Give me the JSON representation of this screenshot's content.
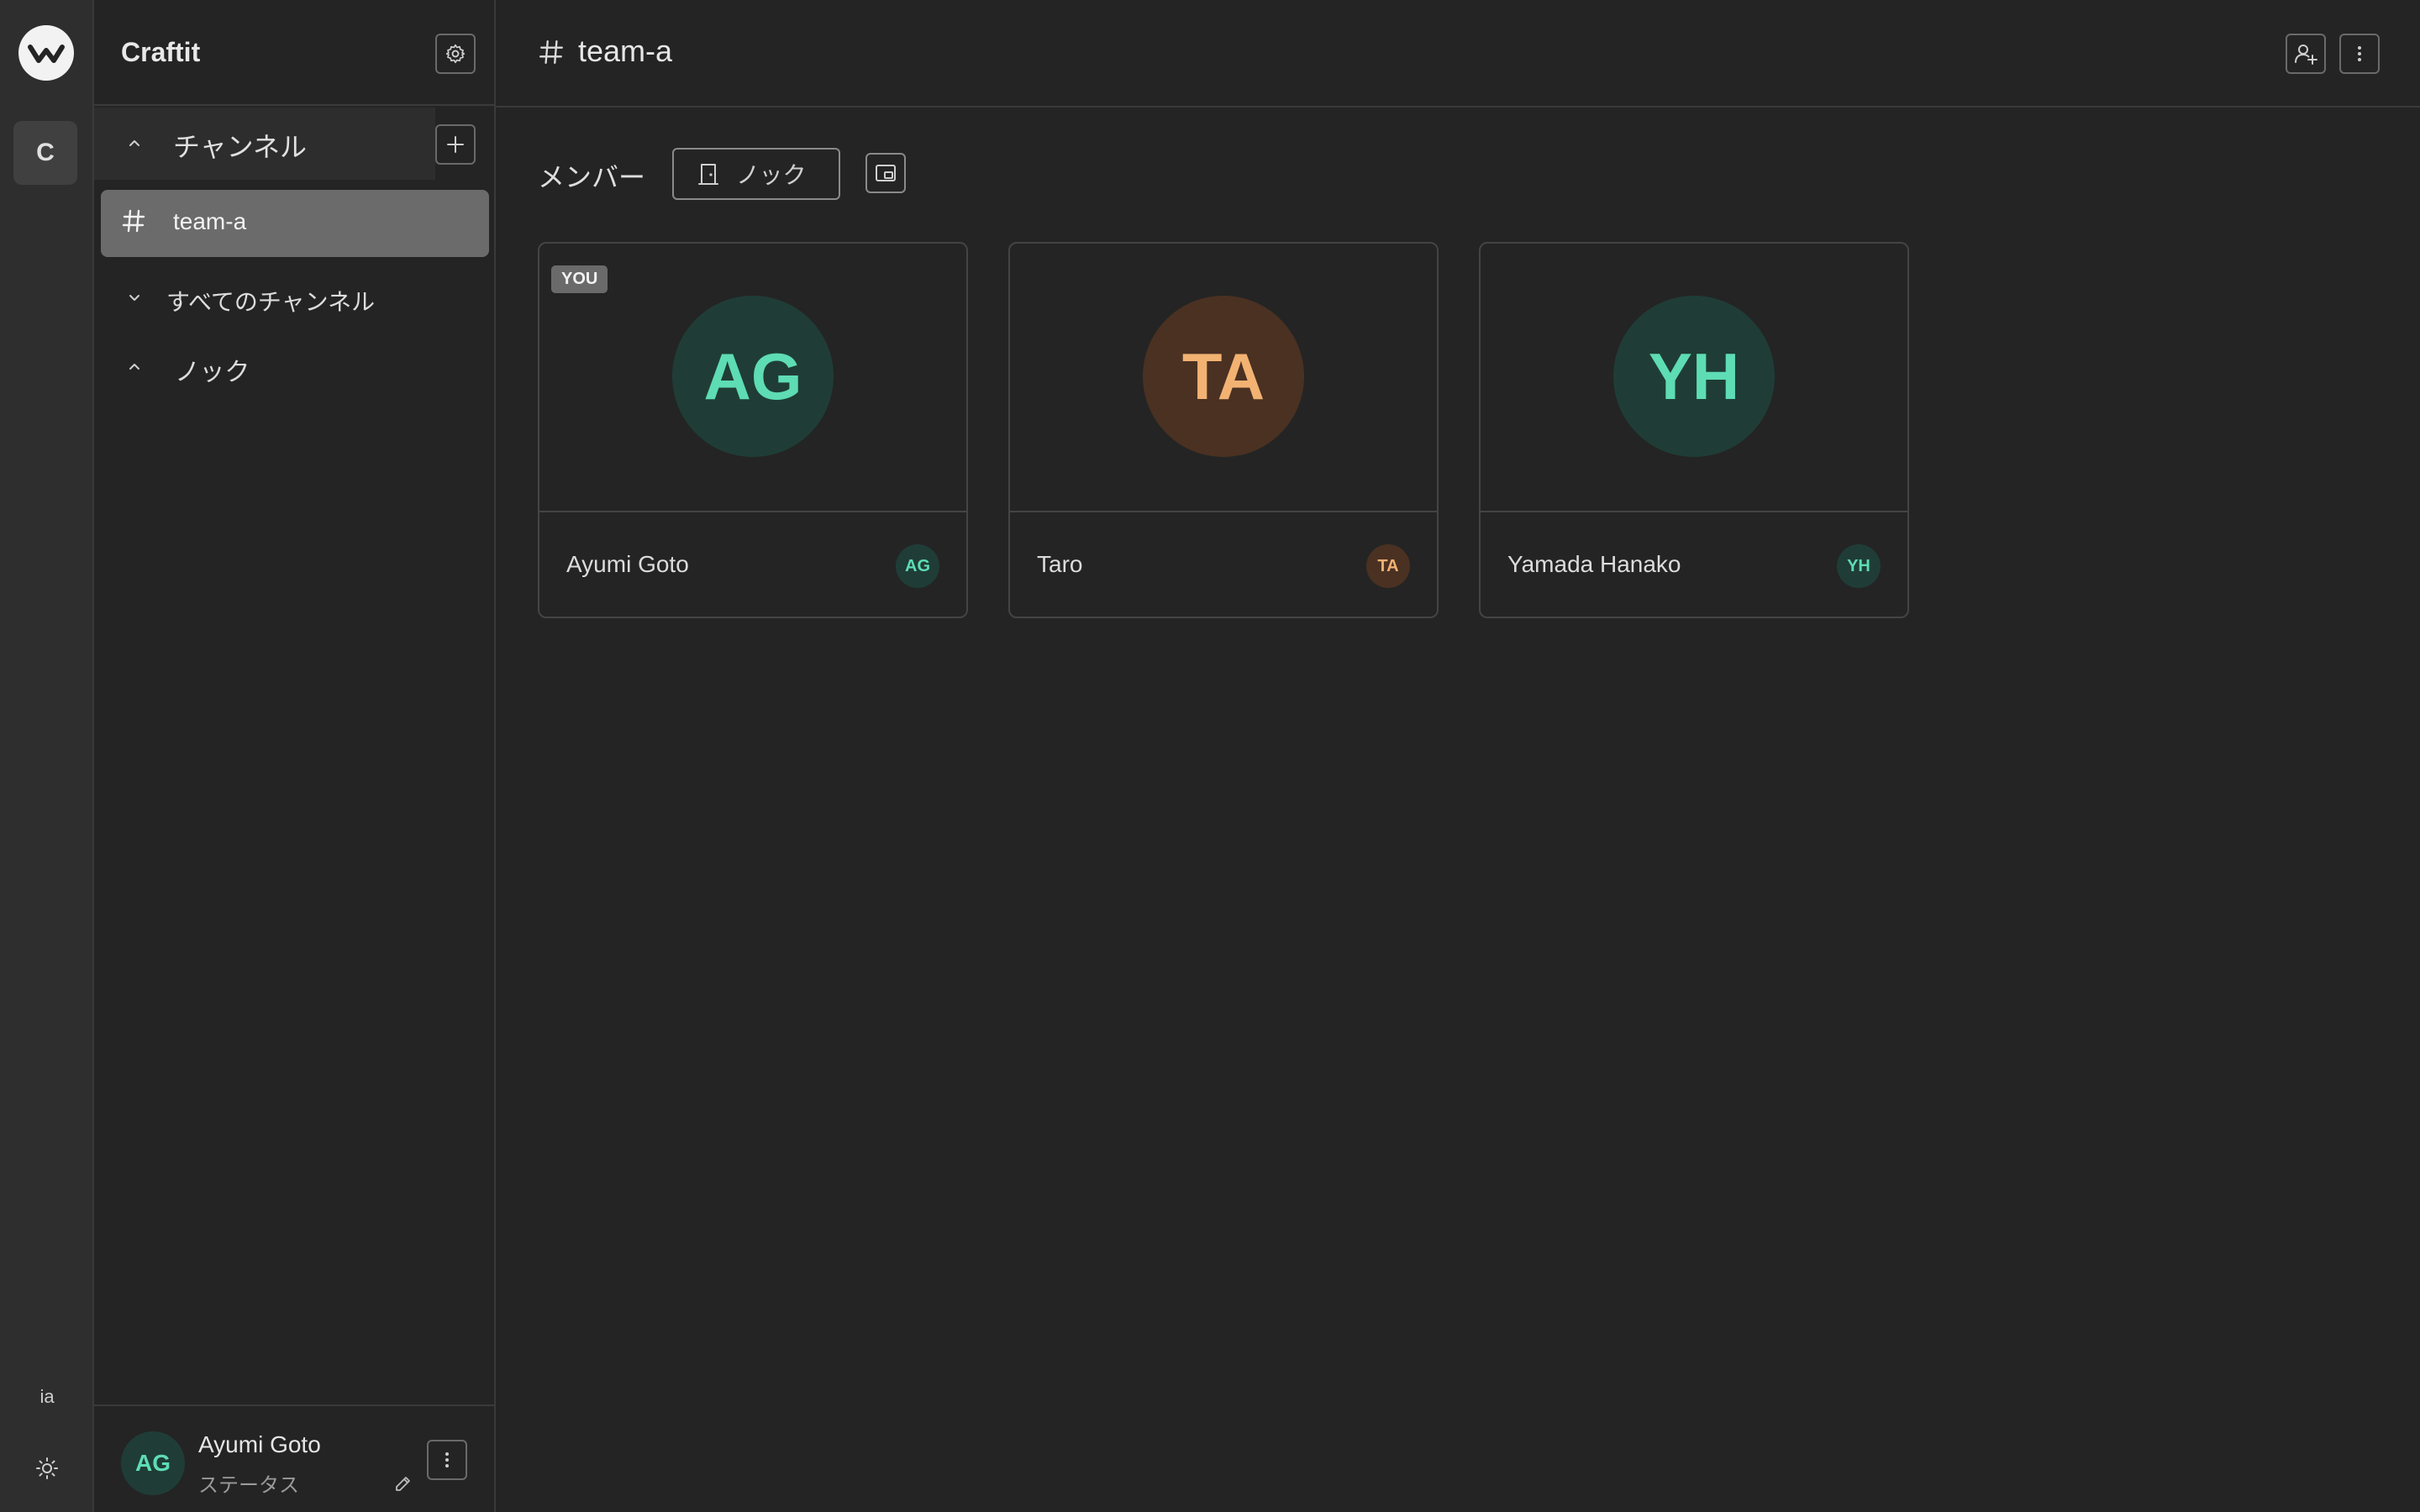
{
  "app": {
    "name": "Craftit"
  },
  "rail": {
    "workspace_initial": "C",
    "language": "ia"
  },
  "sidebar": {
    "title": "Craftit",
    "section_channels": "チャンネル",
    "active_channel": "team-a",
    "all_channels": "すべてのチャンネル",
    "knock_section": "ノック"
  },
  "footer": {
    "initials": "AG",
    "name": "Ayumi Goto",
    "status": "ステータス"
  },
  "header": {
    "channel": "team-a"
  },
  "toolbar": {
    "members_label": "メンバー",
    "knock_label": "ノック"
  },
  "members": [
    {
      "name": "Ayumi Goto",
      "initials": "AG",
      "you_badge": "YOU",
      "color": "#5edcb4"
    },
    {
      "name": "Taro",
      "initials": "TA",
      "color": "#f2b272"
    },
    {
      "name": "Yamada Hanako",
      "initials": "YH",
      "color": "#5edcb4"
    }
  ],
  "colors": {
    "background": "#242424",
    "accent_green": "#5edcb4",
    "accent_orange": "#f2b272"
  },
  "icons": {
    "logo": "app-logo-icon",
    "settings": "gear-icon",
    "add": "plus-icon",
    "hash": "hash-icon",
    "add_user": "add-user-icon",
    "more": "more-vertical-icon",
    "door": "door-icon",
    "pip": "picture-in-picture-icon",
    "theme": "sun-icon",
    "edit": "edit-icon"
  }
}
